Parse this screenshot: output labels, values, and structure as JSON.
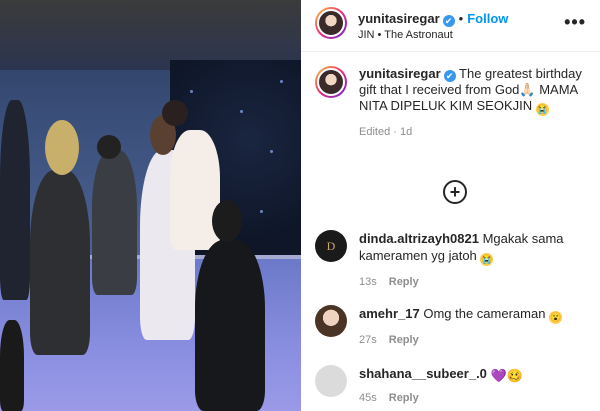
{
  "post": {
    "username": "yunitasiregar",
    "verified_glyph": "✔",
    "follow_label": "Follow",
    "audio": "JIN • The Astronaut",
    "more_glyph": "•••",
    "caption_username": "yunitasiregar",
    "caption_text": "The greatest birthday gift that I received from God🙏🏻 MAMA NITA DIPELUK KIM SEOKJIN",
    "caption_emoji": "😭",
    "edited": "Edited",
    "age": "1d",
    "load_more_glyph": "+"
  },
  "comments": [
    {
      "username": "dinda.altrizayh0821",
      "text": "Mgakak sama kameramen yg jatoh",
      "emoji": "😭",
      "time": "13s",
      "reply": "Reply"
    },
    {
      "username": "amehr_17",
      "text": "Omg the cameraman",
      "emoji": "😮",
      "time": "27s",
      "reply": "Reply"
    },
    {
      "username": "shahana__subeer_.0",
      "text": "",
      "emoji": "💜🥴",
      "time": "45s",
      "reply": "Reply"
    }
  ],
  "icons": [
    "verified-icon",
    "more-icon",
    "plus-circle-icon"
  ],
  "colors": {
    "follow": "#0095f6",
    "verified": "#3897f0",
    "meta": "#8e8e8e"
  }
}
